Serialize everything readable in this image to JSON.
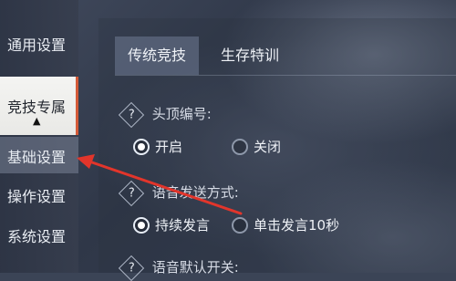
{
  "sidebar": {
    "items": [
      {
        "label": "通用设置"
      },
      {
        "label": "竞技专属"
      },
      {
        "label": "基础设置"
      },
      {
        "label": "操作设置"
      },
      {
        "label": "系统设置"
      }
    ],
    "caret": "▲"
  },
  "tabs": [
    {
      "label": "传统竞技"
    },
    {
      "label": "生存特训"
    }
  ],
  "sections": {
    "head_number": {
      "help": "?",
      "title": "头顶编号:",
      "options": [
        {
          "label": "开启",
          "selected": true
        },
        {
          "label": "关闭",
          "selected": false
        }
      ]
    },
    "voice_send": {
      "help": "?",
      "title": "语音发送方式:",
      "options": [
        {
          "label": "持续发言",
          "selected": true
        },
        {
          "label": "单击发言10秒",
          "selected": false
        }
      ]
    },
    "voice_default": {
      "help": "?",
      "title": "语音默认开关:"
    }
  },
  "colors": {
    "annotation_arrow": "#e2352b",
    "active_tab_accent": "#d45a38"
  },
  "icons": {
    "help": "help-diamond-icon",
    "caret": "caret-up-icon",
    "radio": "radio-icon"
  }
}
